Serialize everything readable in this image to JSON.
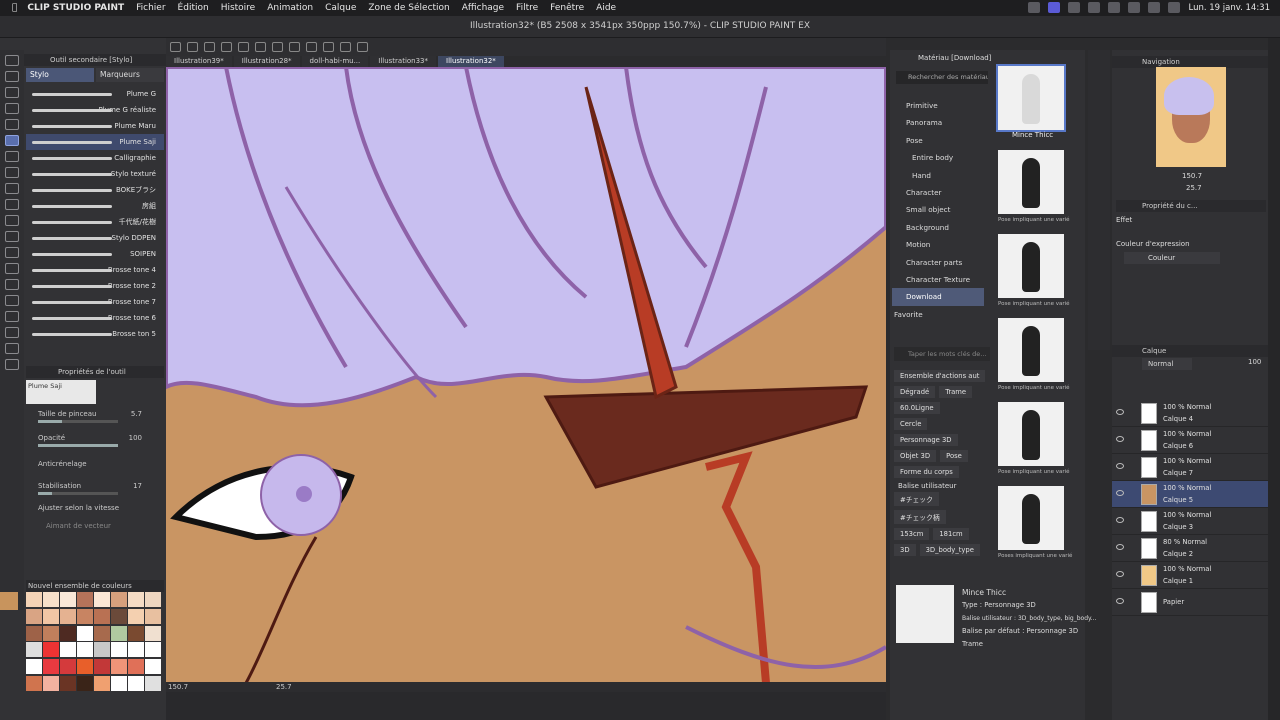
{
  "menubar": {
    "app": "CLIP STUDIO PAINT",
    "items": [
      "Fichier",
      "Édition",
      "Histoire",
      "Animation",
      "Calque",
      "Zone de Sélection",
      "Affichage",
      "Filtre",
      "Fenêtre",
      "Aide"
    ],
    "datetime": "Lun. 19 janv.  14:31"
  },
  "window": {
    "title": "Illustration32* (B5 2508 x 3541px 350ppp 150.7%) - CLIP STUDIO PAINT EX"
  },
  "doc_tabs": [
    "Illustration39*",
    "Illustration28*",
    "doll-habi-mu...",
    "Illustration33*",
    "Illustration32*"
  ],
  "subtool": {
    "header": "Outil secondaire [Stylo]",
    "tabs": [
      "Stylo",
      "Marqueurs"
    ],
    "brushes": [
      "Plume G",
      "Plume G réaliste",
      "Plume Maru",
      "Plume Saji",
      "Calligraphie",
      "Stylo texturé",
      "BOKEブラシ",
      "房組",
      "千代紙/花樹",
      "Stylo DDPEN",
      "SOIPEN",
      "Brosse tone 4",
      "Brosse tone 2",
      "Brosse tone 7",
      "Brosse tone 6",
      "Brosse ton 5"
    ]
  },
  "tool_property": {
    "header": "Propriétés de l'outil",
    "preset": "Plume Saji",
    "brush_size_label": "Taille de pinceau",
    "brush_size": "5.7",
    "opacity_label": "Opacité",
    "opacity": "100",
    "antialias_label": "Anticrénelage",
    "stabilization_label": "Stabilisation",
    "stabilization": "17",
    "speed_label": "Ajuster selon la vitesse",
    "vector_label": "Aimant de vecteur"
  },
  "palette": {
    "header": "Nouvel ensemble de couleurs",
    "colors": [
      "#f4d3b6",
      "#f7e0ca",
      "#f9e8d8",
      "#b5735a",
      "#fbe7d5",
      "#d6a07d",
      "#f5dcc5",
      "#eed6c0",
      "#d9a484",
      "#f1c6a5",
      "#e5b291",
      "#c88462",
      "#b97153",
      "#6b4a3a",
      "#f4d0b0",
      "#e8c0a0",
      "#9e6248",
      "#c07f5c",
      "#4e2a22",
      "#ffffff",
      "#a76a4d",
      "#b0c9a0",
      "#7a4a30",
      "#f0e0d0",
      "#dedede",
      "#e33",
      "#ffffff",
      "#ffffff",
      "#c8c8c8",
      "#ffffff",
      "#ffffff",
      "#ffffff",
      "#ffffff",
      "#e83a40",
      "#d43a3c",
      "#e85f2a",
      "#c23838",
      "#f09478",
      "#e07058",
      "#ffffff",
      "#d0744e",
      "#f2b2a0",
      "#6a3424",
      "#3a2418",
      "#f0a070",
      "#ffffff",
      "#ffffff",
      "#e0e0e0"
    ]
  },
  "status": {
    "zoom": "150.7",
    "angle": "25.7"
  },
  "materials": {
    "header": "Matériau [Download]",
    "search_placeholder": "Rechercher des matériaux s...",
    "tree": [
      "Primitive",
      "Panorama",
      "Pose",
      "Entire body",
      "Hand",
      "Character",
      "Small object",
      "Background",
      "Motion",
      "Character parts",
      "Character Texture",
      "Download",
      "Favorite"
    ],
    "tag_search_placeholder": "Taper les mots clés de...",
    "tag_rows": [
      [
        "Ensemble d'actions aut"
      ],
      [
        "Dégradé",
        "Trame"
      ],
      [
        "60.0Ligne"
      ],
      [
        "Cercle"
      ],
      [
        "Personnage 3D"
      ],
      [
        "Objet 3D",
        "Pose"
      ],
      [
        "Forme du corps"
      ]
    ],
    "tag_header": "Balise utilisateur",
    "user_tags": [
      [
        "#チェック"
      ],
      [
        "#チェック柄"
      ],
      [
        "153cm",
        "181cm"
      ],
      [
        "3D",
        "3D_body_type"
      ]
    ],
    "thumbs": [
      "Mince Thicc",
      "Pose impliquant une varié",
      "Pose impliquant une varié",
      "Pose impliquant une varié",
      "Pose impliquant une varié",
      "Poses impliquant une varié"
    ],
    "info_name": "Mince Thicc",
    "info_type": "Type : Personnage 3D",
    "info_tags": "Balise utilisateur : 3D_body_type, big_body...",
    "info_default": "Balise par défaut : Personnage 3D",
    "info_trame": "Trame"
  },
  "navigator": {
    "header": "Navigation",
    "zoom": "150.7",
    "angle": "25.7"
  },
  "sub_view": {
    "header": "Propriété du c...",
    "effect_label": "Effet",
    "expr_label": "Couleur d'expression",
    "expr_value": "Couleur"
  },
  "layers": {
    "header": "Calque",
    "blend": "Normal",
    "opacity": "100",
    "items": [
      {
        "mode": "100 % Normal",
        "name": "Calque 4"
      },
      {
        "mode": "100 % Normal",
        "name": "Calque 6"
      },
      {
        "mode": "100 % Normal",
        "name": "Calque 7"
      },
      {
        "mode": "100 % Normal",
        "name": "Calque 5"
      },
      {
        "mode": "100 % Normal",
        "name": "Calque 3"
      },
      {
        "mode": "80 % Normal",
        "name": "Calque 2"
      },
      {
        "mode": "100 % Normal",
        "name": "Calque 1"
      },
      {
        "mode": "",
        "name": "Papier"
      }
    ]
  }
}
